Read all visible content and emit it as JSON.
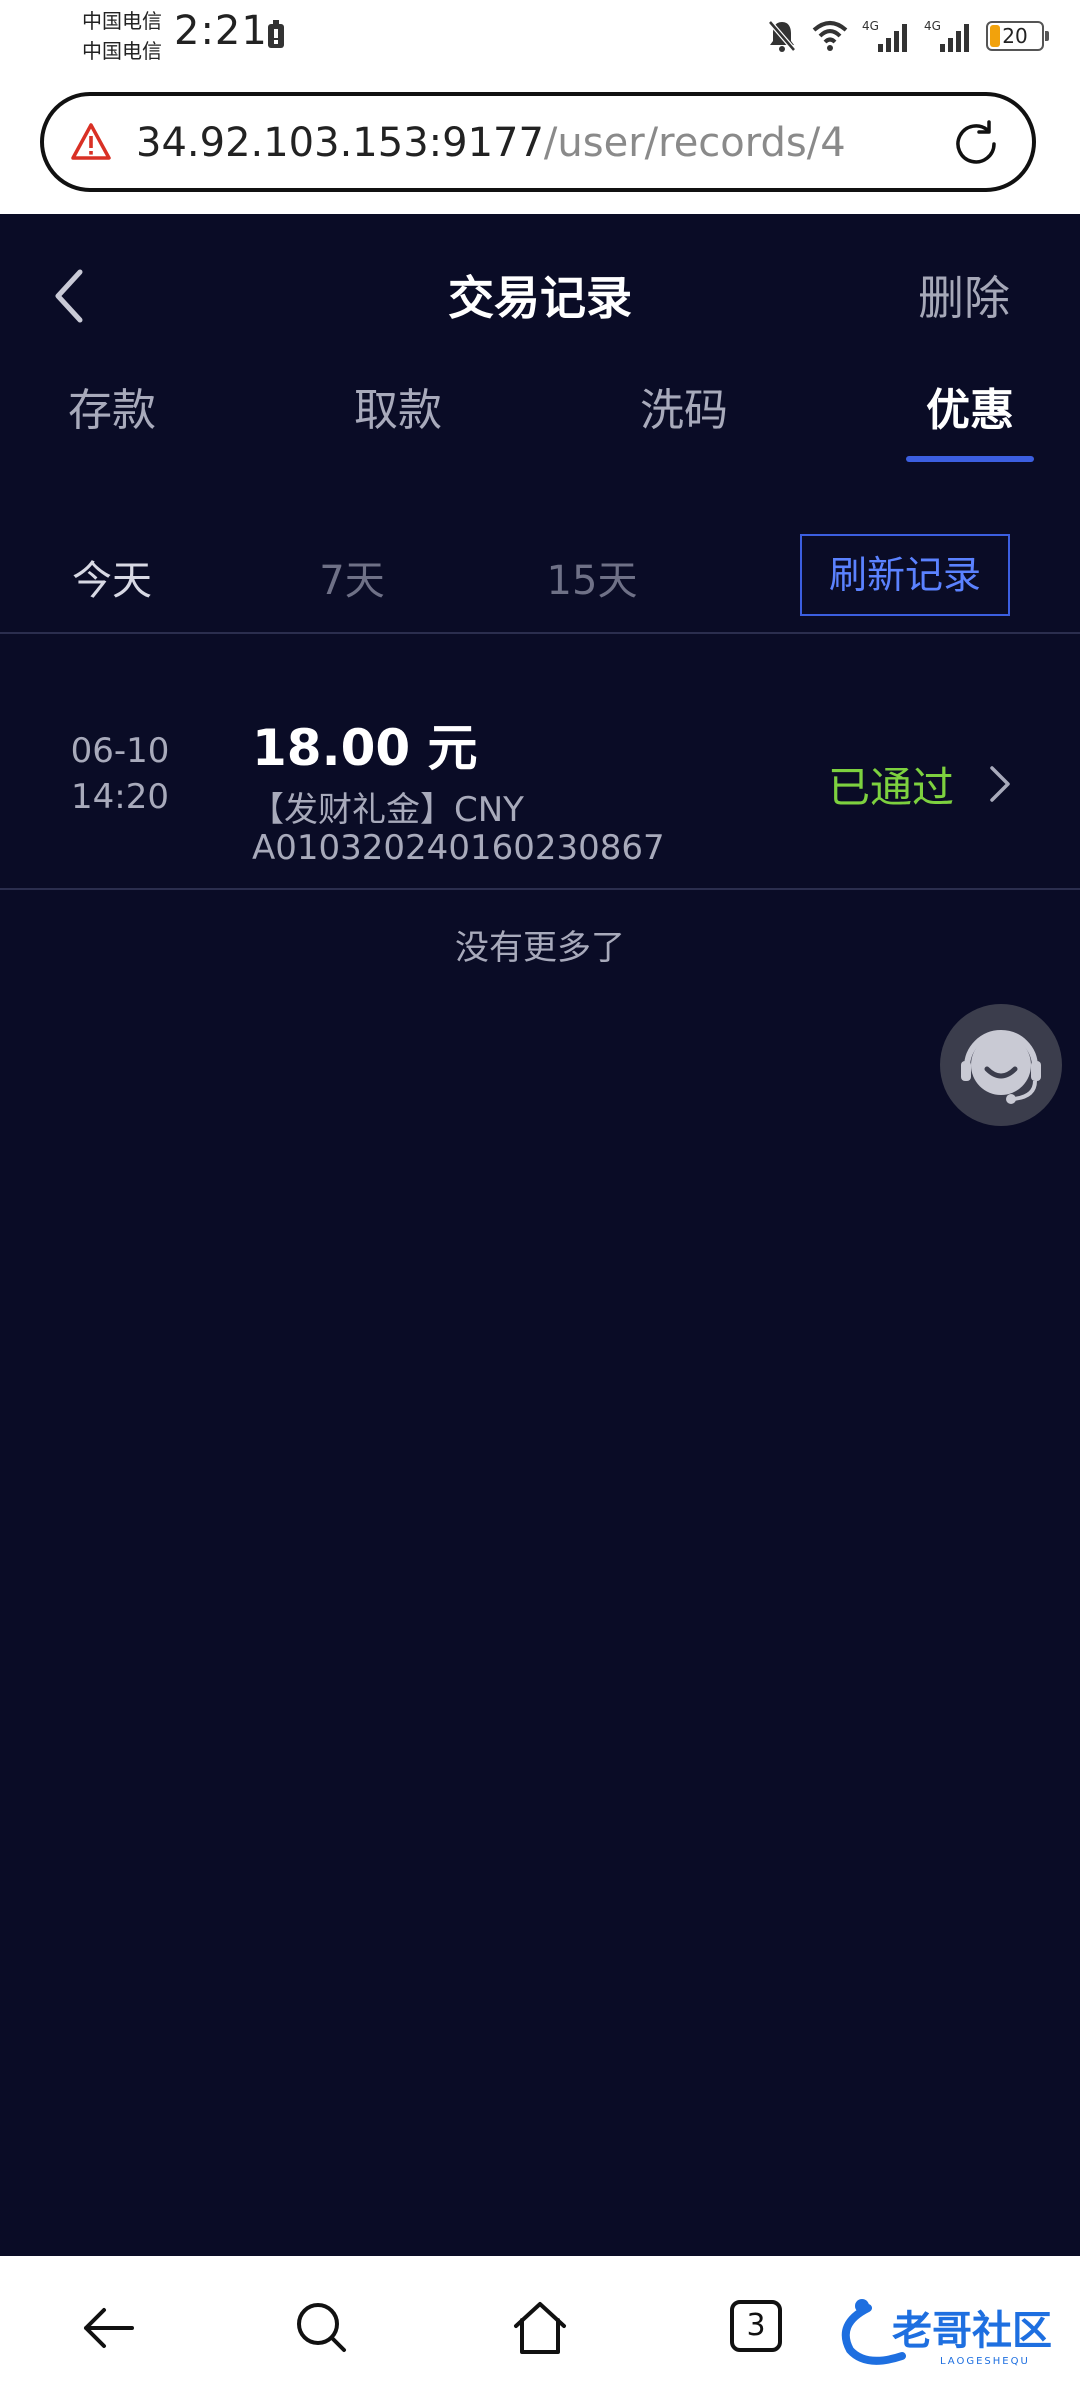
{
  "status_bar": {
    "carrier1": "中国电信",
    "carrier2": "中国电信",
    "time": "2:21",
    "battery": "20",
    "net1": "4G",
    "net2": "4G"
  },
  "browser": {
    "url_host": "34.92.103.153:9177",
    "url_path": "/user/records/4",
    "tabs_count": "3"
  },
  "header": {
    "title": "交易记录",
    "delete_label": "删除"
  },
  "tabs": [
    {
      "label": "存款",
      "active": false
    },
    {
      "label": "取款",
      "active": false
    },
    {
      "label": "洗码",
      "active": false
    },
    {
      "label": "优惠",
      "active": true
    }
  ],
  "ranges": [
    {
      "label": "今天",
      "active": true
    },
    {
      "label": "7天",
      "active": false
    },
    {
      "label": "15天",
      "active": false
    }
  ],
  "refresh_label": "刷新记录",
  "records": [
    {
      "date": "06-10",
      "time": "14:20",
      "amount": "18.00 元",
      "desc": "【发财礼金】CNY",
      "id": "A010320240160230867",
      "status": "已通过"
    }
  ],
  "no_more": "没有更多了",
  "watermark": {
    "text": "老哥社区",
    "sub": "LAOGESHEQU"
  },
  "colors": {
    "background": "#0a0c26",
    "accent": "#3c5fe0",
    "status_ok": "#7dd13f"
  }
}
